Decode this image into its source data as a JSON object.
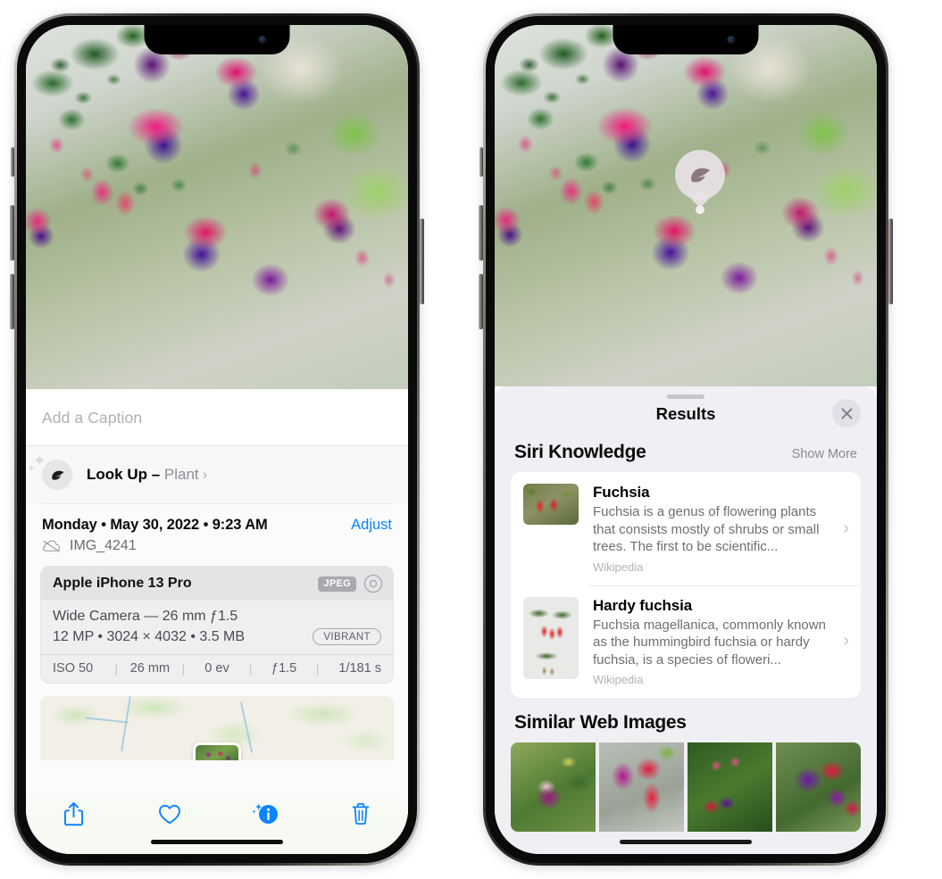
{
  "left_phone": {
    "name": "photos-detail-screen",
    "caption": {
      "placeholder": "Add a Caption",
      "value": ""
    },
    "lookup": {
      "label": "Look Up – ",
      "subject": "Plant",
      "chevron": "›",
      "icon": "leaf-icon"
    },
    "date_row": {
      "date": "Monday • May 30, 2022 • 9:23 AM",
      "adjust": "Adjust"
    },
    "filename": {
      "name": "IMG_4241",
      "icon": "icloud-slash-icon"
    },
    "camera_card": {
      "model": "Apple iPhone 13 Pro",
      "format_badge": "JPEG",
      "raw_icon": "raw-toggle-icon",
      "lens_line": "Wide Camera — 26 mm ƒ1.5",
      "size_line": "12 MP • 3024 × 4032 • 3.5 MB",
      "style_badge": "VIBRANT",
      "stats": [
        "ISO 50",
        "26 mm",
        "0 ev",
        "ƒ1.5",
        "1/181 s"
      ]
    },
    "toolbar": [
      {
        "label": "Share",
        "icon": "share-icon",
        "color": "#0a84ff"
      },
      {
        "label": "Favorite",
        "icon": "heart-icon",
        "color": "#0a84ff"
      },
      {
        "label": "Info",
        "icon": "info-sparkle-icon",
        "color": "#0a84ff"
      },
      {
        "label": "Delete",
        "icon": "trash-icon",
        "color": "#0a84ff"
      }
    ]
  },
  "right_phone": {
    "name": "visual-lookup-results-screen",
    "bubble": {
      "icon": "leaf-icon"
    },
    "sheet": {
      "title": "Results",
      "close_icon": "close-icon",
      "sections": [
        {
          "title": "Siri Knowledge",
          "action": "Show More",
          "items": [
            {
              "title": "Fuchsia",
              "description": "Fuchsia is a genus of flowering plants that consists mostly of shrubs or small trees. The first to be scientific...",
              "source": "Wikipedia",
              "chevron": "›"
            },
            {
              "title": "Hardy fuchsia",
              "description": "Fuchsia magellanica, commonly known as the hummingbird fuchsia or hardy fuchsia, is a species of floweri...",
              "source": "Wikipedia",
              "chevron": "›"
            }
          ]
        },
        {
          "title": "Similar Web Images",
          "tiles": [
            "fuchsia-web-image-1",
            "fuchsia-web-image-2",
            "fuchsia-web-image-3",
            "fuchsia-web-image-4"
          ]
        }
      ]
    }
  },
  "colors": {
    "accent": "#0a84ff",
    "sheet_bg": "#f0eff4",
    "card_bg": "#ffffff",
    "secondary_text": "#8e8e93"
  }
}
